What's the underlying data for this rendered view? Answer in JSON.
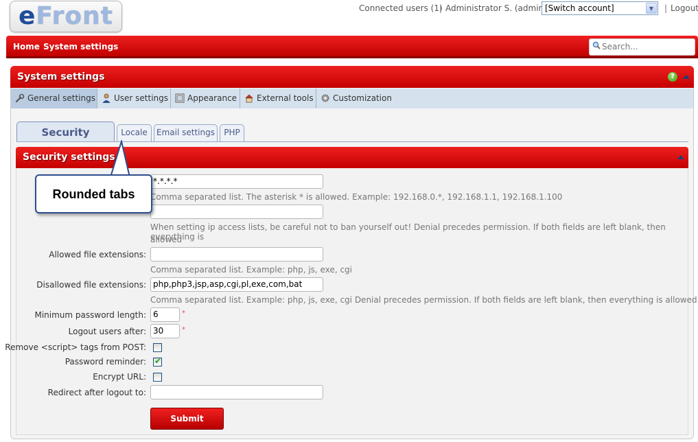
{
  "logo": {
    "first": "e",
    "rest": "Front"
  },
  "header": {
    "connected_users": "Connected users (1)",
    "user": "Administrator S. (admin)",
    "switch_account": "[Switch account]",
    "logout": "Logout",
    "separator": "|"
  },
  "nav": {
    "home": "Home",
    "system_settings": "System settings",
    "search_placeholder": "Search..."
  },
  "panel": {
    "title": "System settings",
    "help": "?"
  },
  "tabs": [
    {
      "label": "General settings",
      "icon": "wrench-icon",
      "active": true
    },
    {
      "label": "User settings",
      "icon": "user-icon"
    },
    {
      "label": "Appearance",
      "icon": "appearance-icon"
    },
    {
      "label": "External tools",
      "icon": "house-icon"
    },
    {
      "label": "Customization",
      "icon": "gear-icon"
    }
  ],
  "subtabs": [
    {
      "label": "Security settings",
      "active": true
    },
    {
      "label": "Locale"
    },
    {
      "label": "Email settings"
    },
    {
      "label": "PHP"
    }
  ],
  "section": {
    "title": "Security settings"
  },
  "callout": {
    "text": "Rounded tabs"
  },
  "form": {
    "allowed_ips_value": "*.*.*.*",
    "allowed_ips_hint": "Comma separated list. The asterisk * is allowed. Example: 192.168.0.*, 192.168.1.1, 192.168.1.100",
    "disallowed_ips_value": "",
    "disallowed_ips_hint_line1": "When setting ip access lists, be careful not to ban yourself out! Denial precedes permission. If both fields are left blank, then everything is",
    "disallowed_ips_hint_line2": "allowed",
    "allowed_ext_label": "Allowed file extensions:",
    "allowed_ext_value": "",
    "allowed_ext_hint": "Comma separated list. Example: php, js, exe, cgi",
    "disallowed_ext_label": "Disallowed file extensions:",
    "disallowed_ext_value": "php,php3,jsp,asp,cgi,pl,exe,com,bat",
    "disallowed_ext_hint": "Comma separated list. Example: php, js, exe, cgi Denial precedes permission. If both fields are left blank, then everything is allowed",
    "min_pw_label": "Minimum password length:",
    "min_pw_value": "6",
    "logout_after_label": "Logout users after:",
    "logout_after_value": "30",
    "required_mark": "*",
    "remove_script_label": "Remove <script> tags from POST:",
    "remove_script_checked": false,
    "pw_reminder_label": "Password reminder:",
    "pw_reminder_checked": true,
    "encrypt_url_label": "Encrypt URL:",
    "encrypt_url_checked": false,
    "redirect_label": "Redirect after logout to:",
    "redirect_value": "",
    "submit": "Submit"
  },
  "colors": {
    "brand_red": "#d80000",
    "tab_blue": "#d5e2ee",
    "link_navy": "#4b5a87"
  }
}
